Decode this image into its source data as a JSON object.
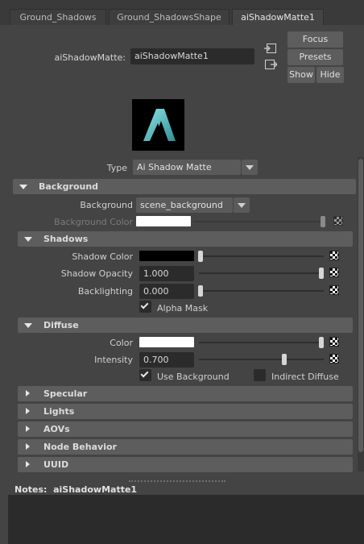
{
  "tabs": [
    {
      "label": "Ground_Shadows"
    },
    {
      "label": "Ground_ShadowsShape"
    },
    {
      "label": "aiShadowMatte1"
    }
  ],
  "header": {
    "node_label": "aiShadowMatte:",
    "node_value": "aiShadowMatte1",
    "focus": "Focus",
    "presets": "Presets",
    "show": "Show",
    "hide": "Hide"
  },
  "type_row": {
    "label": "Type",
    "value": "Ai Shadow Matte"
  },
  "sections": {
    "background": {
      "title": "Background",
      "background_label": "Background",
      "background_value": "scene_background",
      "background_color_label": "Background Color",
      "background_color_level": 0.95
    },
    "shadows": {
      "title": "Shadows",
      "shadow_color_label": "Shadow Color",
      "shadow_color_level": 0.0,
      "shadow_opacity_label": "Shadow Opacity",
      "shadow_opacity_value": "1.000",
      "backlighting_label": "Backlighting",
      "backlighting_value": "0.000",
      "alpha_mask_label": "Alpha Mask",
      "alpha_mask_checked": true
    },
    "diffuse": {
      "title": "Diffuse",
      "color_label": "Color",
      "color_level": 1.0,
      "intensity_label": "Intensity",
      "intensity_value": "0.700",
      "use_background_label": "Use Background",
      "use_background_checked": true,
      "indirect_diffuse_label": "Indirect Diffuse",
      "indirect_diffuse_checked": false
    },
    "collapsed": [
      {
        "title": "Specular"
      },
      {
        "title": "Lights"
      },
      {
        "title": "AOVs"
      },
      {
        "title": "Node Behavior"
      },
      {
        "title": "UUID"
      }
    ]
  },
  "notes": {
    "label": "Notes:",
    "value": "aiShadowMatte1"
  },
  "colors": {
    "panel_bg": "#444444",
    "section_bg": "#5d5d5d",
    "field_bg": "#2b2b2b",
    "logo_teal": "#5fc6c7"
  },
  "icons": [
    "input-connection-icon",
    "output-connection-icon",
    "dropdown-arrow-icon",
    "checker-map-icon",
    "expand-triangle-icon",
    "collapse-triangle-icon",
    "arnold-logo-icon"
  ]
}
